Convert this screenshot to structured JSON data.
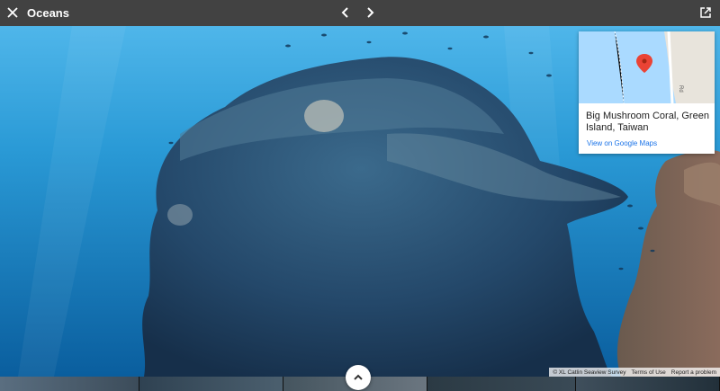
{
  "header": {
    "title": "Oceans",
    "icons": [
      "close-icon",
      "chevron-left-icon",
      "chevron-right-icon",
      "open-in-new-icon"
    ]
  },
  "map_card": {
    "place": "Big Mushroom Coral, Green Island, Taiwan",
    "link": "View on Google Maps",
    "map_road_label": "Rd"
  },
  "footer": {
    "attribution": "© XL Catlin Seaview Survey",
    "terms": "Terms of Use",
    "report": "Report a problem"
  },
  "colors": {
    "topbar": "#424242",
    "water_light": "#2a9ad6",
    "water_deep": "#0a4f86",
    "coral": "#26496a",
    "link": "#1a73e8"
  }
}
